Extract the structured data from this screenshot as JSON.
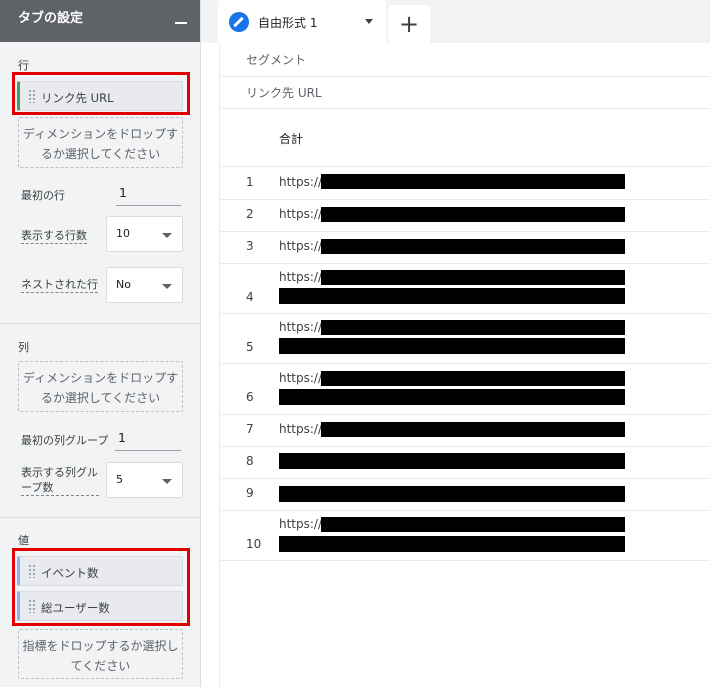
{
  "panel": {
    "title": "タブの設定",
    "rows_section": {
      "label": "行",
      "dimension_chip": "リンク先 URL",
      "drop_zone": "ディメンションをドロップするか選択してください",
      "first_row_label": "最初の行",
      "first_row_value": "1",
      "show_rows_label": "表示する行数",
      "show_rows_value": "10",
      "nested_rows_label": "ネストされた行",
      "nested_rows_value": "No"
    },
    "columns_section": {
      "label": "列",
      "drop_zone": "ディメンションをドロップするか選択してください",
      "first_col_group_label": "最初の列グループ",
      "first_col_group_value": "1",
      "show_col_groups_label": "表示する列グループ数",
      "show_col_groups_value": "5"
    },
    "values_section": {
      "label": "値",
      "metric_chips": [
        "イベント数",
        "総ユーザー数"
      ],
      "drop_zone": "指標をドロップするか選択してください"
    }
  },
  "tabs": {
    "active_tab": "自由形式 1",
    "add_tab_label": "+"
  },
  "report": {
    "segment_label": "セグメント",
    "dimension_header": "リンク先 URL",
    "total_label": "合計",
    "rows": [
      {
        "index": "1",
        "url_prefix": "https://"
      },
      {
        "index": "2",
        "url_prefix": "https://"
      },
      {
        "index": "3",
        "url_prefix": "https://"
      },
      {
        "index": "4",
        "url_prefix": "https://"
      },
      {
        "index": "5",
        "url_prefix": "https://"
      },
      {
        "index": "6",
        "url_prefix": "https://"
      },
      {
        "index": "7",
        "url_prefix": "https://"
      },
      {
        "index": "8",
        "url_prefix": ""
      },
      {
        "index": "9",
        "url_prefix": ""
      },
      {
        "index": "10",
        "url_prefix": "https://"
      }
    ]
  },
  "colors": {
    "dimension_accent": "#34a853",
    "metric_accent": "#8ab4f8",
    "highlight": "#e00000",
    "tab_icon": "#1a73e8"
  },
  "icons": {
    "tab_icon": "pencil-icon",
    "collapse": "minus-icon",
    "add_tab": "plus-icon"
  }
}
